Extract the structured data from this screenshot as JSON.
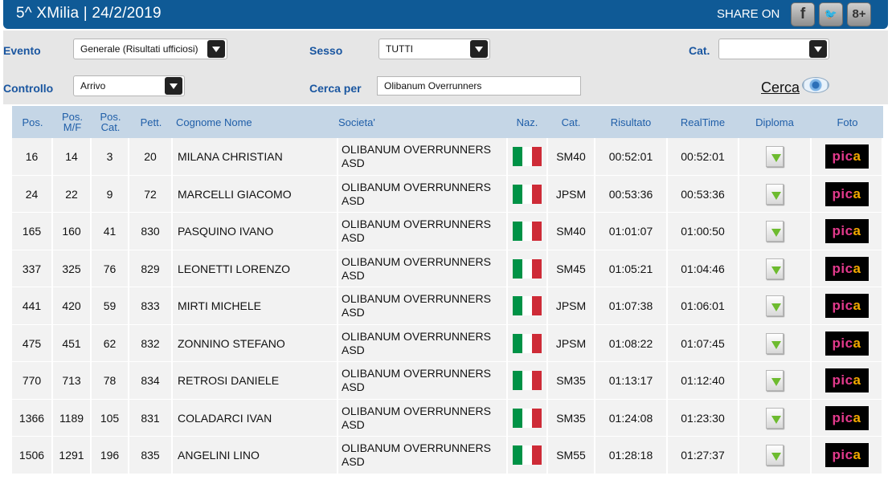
{
  "header": {
    "title": "5^ XMilia  |  24/2/2019",
    "share_label": "SHARE ON",
    "social": [
      {
        "icon": "facebook-icon",
        "glyph": "f"
      },
      {
        "icon": "twitter-icon",
        "glyph": "🐦"
      },
      {
        "icon": "google-plus-icon",
        "glyph": "8+"
      }
    ]
  },
  "filters": {
    "evento_label": "Evento",
    "evento_value": "Generale (Risultati ufficiosi)",
    "sesso_label": "Sesso",
    "sesso_value": "TUTTI",
    "cat_label": "Cat.",
    "cat_value": "",
    "controllo_label": "Controllo",
    "controllo_value": "Arrivo",
    "cerca_per_label": "Cerca per",
    "cerca_per_value": "Olibanum Overrunners",
    "cerca_button": "Cerca"
  },
  "table": {
    "headers": {
      "pos": "Pos.",
      "pos_mf": "Pos. M/F",
      "pos_cat": "Pos. Cat.",
      "pett": "Pett.",
      "name": "Cognome Nome",
      "societa": "Societa'",
      "naz": "Naz.",
      "cat": "Cat.",
      "risultato": "Risultato",
      "realtime": "RealTime",
      "diploma": "Diploma",
      "foto": "Foto"
    },
    "rows": [
      {
        "pos": "16",
        "pos_mf": "14",
        "pos_cat": "3",
        "pett": "20",
        "name": "MILANA CHRISTIAN",
        "societa": "OLIBANUM OVERRUNNERS ASD",
        "cat": "SM40",
        "risultato": "00:52:01",
        "realtime": "00:52:01"
      },
      {
        "pos": "24",
        "pos_mf": "22",
        "pos_cat": "9",
        "pett": "72",
        "name": "MARCELLI GIACOMO",
        "societa": "OLIBANUM OVERRUNNERS ASD",
        "cat": "JPSM",
        "risultato": "00:53:36",
        "realtime": "00:53:36"
      },
      {
        "pos": "165",
        "pos_mf": "160",
        "pos_cat": "41",
        "pett": "830",
        "name": "PASQUINO IVANO",
        "societa": "OLIBANUM OVERRUNNERS ASD",
        "cat": "SM40",
        "risultato": "01:01:07",
        "realtime": "01:00:50"
      },
      {
        "pos": "337",
        "pos_mf": "325",
        "pos_cat": "76",
        "pett": "829",
        "name": "LEONETTI LORENZO",
        "societa": "OLIBANUM OVERRUNNERS ASD",
        "cat": "SM45",
        "risultato": "01:05:21",
        "realtime": "01:04:46"
      },
      {
        "pos": "441",
        "pos_mf": "420",
        "pos_cat": "59",
        "pett": "833",
        "name": "MIRTI MICHELE",
        "societa": "OLIBANUM OVERRUNNERS ASD",
        "cat": "JPSM",
        "risultato": "01:07:38",
        "realtime": "01:06:01"
      },
      {
        "pos": "475",
        "pos_mf": "451",
        "pos_cat": "62",
        "pett": "832",
        "name": "ZONNINO STEFANO",
        "societa": "OLIBANUM OVERRUNNERS ASD",
        "cat": "JPSM",
        "risultato": "01:08:22",
        "realtime": "01:07:45"
      },
      {
        "pos": "770",
        "pos_mf": "713",
        "pos_cat": "78",
        "pett": "834",
        "name": "RETROSI DANIELE",
        "societa": "OLIBANUM OVERRUNNERS ASD",
        "cat": "SM35",
        "risultato": "01:13:17",
        "realtime": "01:12:40"
      },
      {
        "pos": "1366",
        "pos_mf": "1189",
        "pos_cat": "105",
        "pett": "831",
        "name": "COLADARCI IVAN",
        "societa": "OLIBANUM OVERRUNNERS ASD",
        "cat": "SM35",
        "risultato": "01:24:08",
        "realtime": "01:23:30"
      },
      {
        "pos": "1506",
        "pos_mf": "1291",
        "pos_cat": "196",
        "pett": "835",
        "name": "ANGELINI LINO",
        "societa": "OLIBANUM OVERRUNNERS ASD",
        "cat": "SM55",
        "risultato": "01:28:18",
        "realtime": "01:27:37"
      }
    ],
    "flag_colors": [
      "#009246",
      "#ffffff",
      "#ce2b37"
    ],
    "foto_brand": "pica"
  },
  "colors": {
    "header_blue": "#0f5a96",
    "label_blue": "#1a56a0",
    "table_header_bg": "#c5d6e6"
  }
}
